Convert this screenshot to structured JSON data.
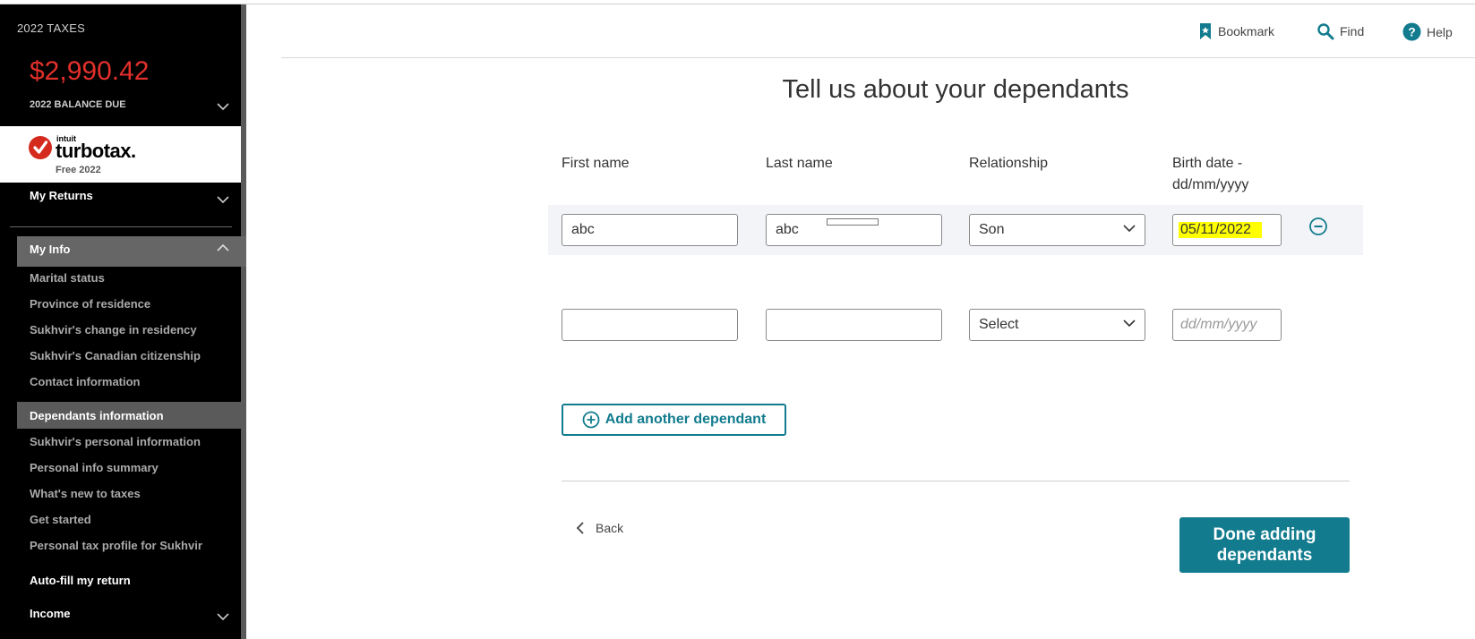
{
  "sidebar": {
    "tax_year_label": "2022 TAXES",
    "balance_amount": "$2,990.42",
    "balance_label": "2022 BALANCE DUE",
    "logo": {
      "brand_top": "intuit",
      "brand_name": "turbotax.",
      "edition": "Free 2022"
    },
    "sections": {
      "my_returns": "My Returns",
      "my_info": "My Info",
      "auto_fill": "Auto-fill my return",
      "income": "Income"
    },
    "items": [
      {
        "label": "Marital status"
      },
      {
        "label": "Province of residence"
      },
      {
        "label": "Sukhvir's change in residency"
      },
      {
        "label": "Sukhvir's Canadian citizenship"
      },
      {
        "label": "Contact information"
      },
      {
        "label": "Dependants information",
        "active": true
      },
      {
        "label": "Sukhvir's personal information"
      },
      {
        "label": "Personal info summary"
      },
      {
        "label": "What's new to taxes"
      },
      {
        "label": "Get started"
      },
      {
        "label": "Personal tax profile for Sukhvir"
      }
    ]
  },
  "header": {
    "bookmark": "Bookmark",
    "find": "Find",
    "help": "Help"
  },
  "main": {
    "title": "Tell us about your dependants",
    "columns": {
      "first_name": "First name",
      "last_name": "Last name",
      "relationship": "Relationship",
      "birth_date_line1": "Birth date -",
      "birth_date_line2": "dd/mm/yyyy"
    },
    "rows": [
      {
        "first_name": "abc",
        "last_name": "abc",
        "relationship": "Son",
        "birth_date": "05/11/2022"
      },
      {
        "first_name": "",
        "last_name": "",
        "relationship": "Select",
        "birth_date_placeholder": "dd/mm/yyyy"
      }
    ],
    "add_button": "Add another dependant",
    "back": "Back",
    "done_line1": "Done adding",
    "done_line2": "dependants"
  },
  "colors": {
    "accent": "#127c8e",
    "balance_red": "#e2302b",
    "highlight": "#ffff00"
  }
}
